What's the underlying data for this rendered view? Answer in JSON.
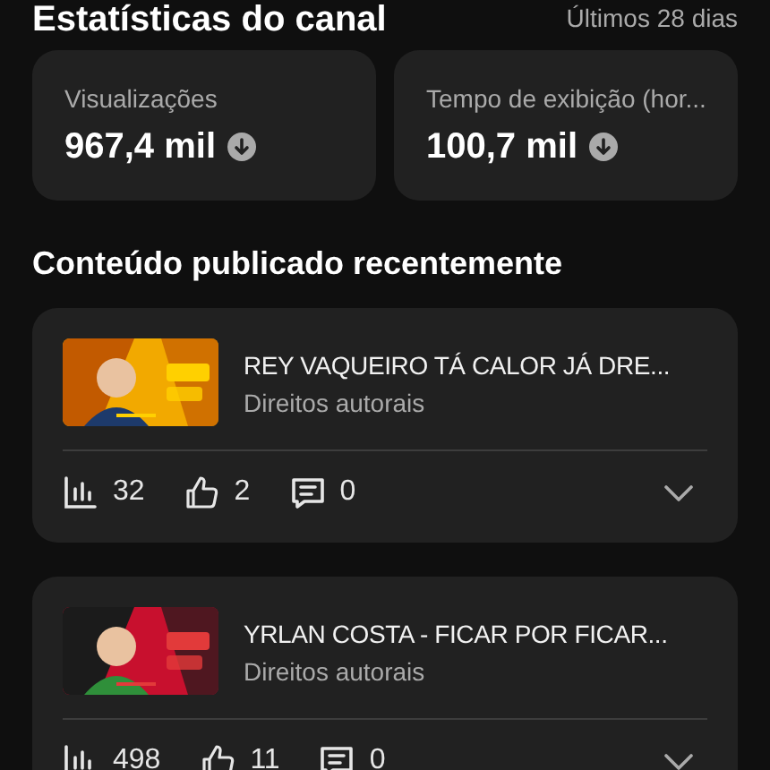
{
  "header": {
    "title": "Estatísticas do canal",
    "period": "Últimos 28 dias"
  },
  "stats": [
    {
      "label": "Visualizações",
      "value": "967,4 mil"
    },
    {
      "label": "Tempo de exibição (hor...",
      "value": "100,7 mil"
    }
  ],
  "section_title": "Conteúdo publicado recentemente",
  "videos": [
    {
      "title": "REY VAQUEIRO TÁ CALOR JÁ DRE...",
      "subtitle": "Direitos autorais",
      "views": "32",
      "likes": "2",
      "comments": "0"
    },
    {
      "title": "YRLAN COSTA - FICAR POR FICAR...",
      "subtitle": "Direitos autorais",
      "views": "498",
      "likes": "11",
      "comments": "0"
    }
  ]
}
